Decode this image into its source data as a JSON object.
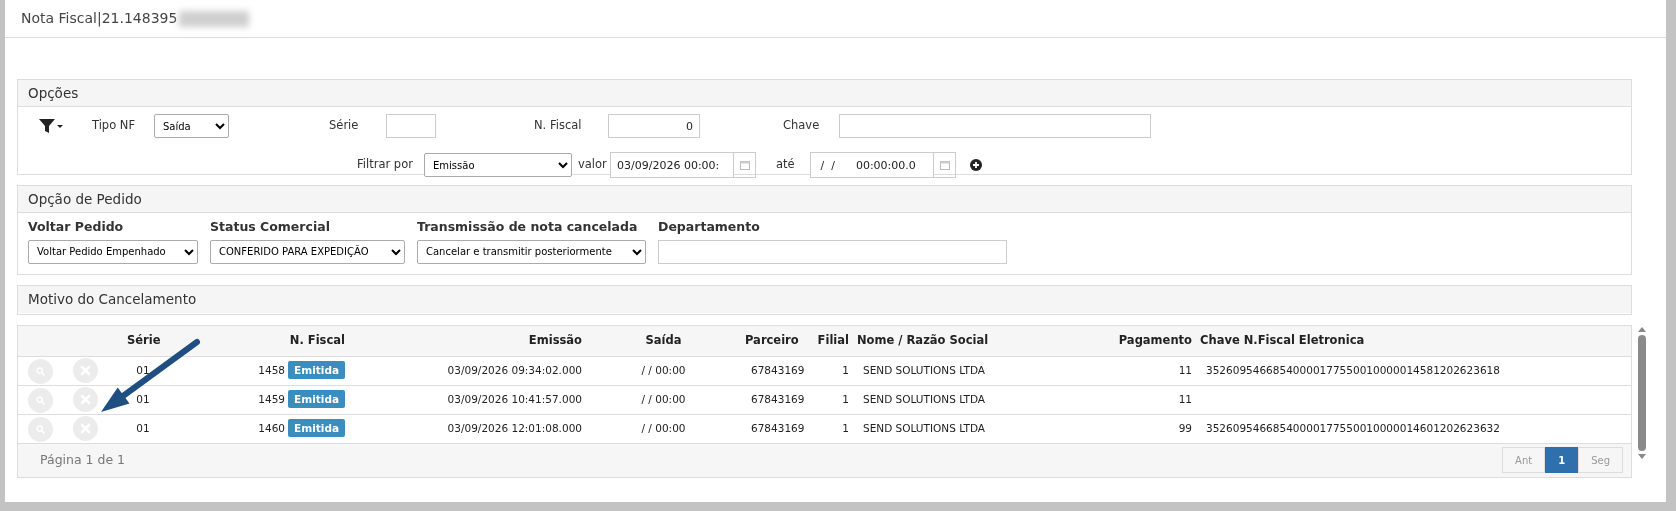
{
  "window": {
    "title": "Nota Fiscal|21.148395"
  },
  "options_panel": {
    "title": "Opções",
    "tipo_nf": {
      "label": "Tipo NF",
      "value": "Saída"
    },
    "serie": {
      "label": "Série"
    },
    "n_fiscal": {
      "label": "N. Fiscal",
      "value": "0"
    },
    "chave": {
      "label": "Chave"
    },
    "filtrar_por": {
      "label": "Filtrar por",
      "value": "Emissão"
    },
    "valor": {
      "label": "valor",
      "value": "03/09/2026 00:00:"
    },
    "ate": {
      "label": "até",
      "value": " /  /      00:00:00.0"
    }
  },
  "order_panel": {
    "title": "Opção de Pedido",
    "fields": [
      {
        "label": "Voltar Pedido",
        "value": "Voltar Pedido Empenhado",
        "kind": "select"
      },
      {
        "label": "Status Comercial",
        "value": "CONFERIDO PARA EXPEDIÇÃO",
        "kind": "select"
      },
      {
        "label": "Transmissão de nota cancelada",
        "value": "Cancelar e transmitir posteriormente",
        "kind": "select"
      },
      {
        "label": "Departamento",
        "kind": "text"
      }
    ]
  },
  "reason_panel": {
    "title": "Motivo do Cancelamento"
  },
  "table": {
    "columns": [
      "Série",
      "N. Fiscal",
      "Emissão",
      "Saída",
      "Parceiro",
      "Filial",
      "Nome / Razão Social",
      "Pagamento",
      "Chave N.Fiscal Eletronica"
    ],
    "rows": [
      {
        "serie": "01",
        "n_fiscal": "1458",
        "status": "Emitida",
        "emissao": "03/09/2026 09:34:02.000",
        "saida": "/ / 00:00",
        "parceiro": "67843169",
        "filial": "1",
        "nome": "SEND SOLUTIONS LTDA",
        "pagamento": "11",
        "chave": "35260954668540000177550010000014581202623618"
      },
      {
        "serie": "01",
        "n_fiscal": "1459",
        "status": "Emitida",
        "emissao": "03/09/2026 10:41:57.000",
        "saida": "/ / 00:00",
        "parceiro": "67843169",
        "filial": "1",
        "nome": "SEND SOLUTIONS LTDA",
        "pagamento": "11"
      },
      {
        "serie": "01",
        "n_fiscal": "1460",
        "status": "Emitida",
        "emissao": "03/09/2026 12:01:08.000",
        "saida": "/ / 00:00",
        "parceiro": "67843169",
        "filial": "1",
        "nome": "SEND SOLUTIONS LTDA",
        "pagamento": "99",
        "chave": "35260954668540000177550010000014601202623632"
      }
    ],
    "footer": {
      "info": "Página 1 de 1",
      "pages": [
        {
          "label": "Ant",
          "selected": false,
          "disabled": true
        },
        {
          "label": "1",
          "selected": true,
          "disabled": false
        },
        {
          "label": "Seg",
          "selected": false,
          "disabled": true
        }
      ]
    }
  }
}
